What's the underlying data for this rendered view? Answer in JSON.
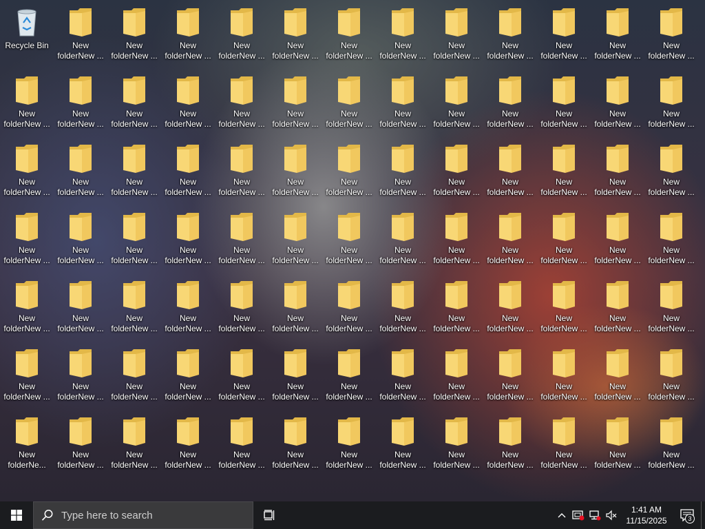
{
  "desktop": {
    "recycle_bin": {
      "label": "Recycle Bin",
      "icon": "recycle-bin-icon"
    },
    "folders": [
      "New folderNew ...",
      "New folderNew ...",
      "New folderNew ...",
      "New folderNew ...",
      "New folderNew ...",
      "New folderNew ...",
      "New folderNew ...",
      "New folderNew ...",
      "New folderNew ...",
      "New folderNew ...",
      "New folderNew ...",
      "New folderNew ...",
      "New folderNew ...",
      "New folderNew ...",
      "New folderNew ...",
      "New folderNew ...",
      "New folderNew ...",
      "New folderNew ...",
      "New folderNew ...",
      "New folderNew ...",
      "New folderNew ...",
      "New folderNew ...",
      "New folderNew ...",
      "New folderNew ...",
      "New folderNew ...",
      "New folderNew ...",
      "New folderNew ...",
      "New folderNew ...",
      "New folderNew ...",
      "New folderNew ...",
      "New folderNew ...",
      "New folderNew ...",
      "New folderNew ...",
      "New folderNew ...",
      "New folderNew ...",
      "New folderNew ...",
      "New folderNew ...",
      "New folderNew ...",
      "New folderNew ...",
      "New folderNew ...",
      "New folderNew ...",
      "New folderNew ...",
      "New folderNew ...",
      "New folderNew ...",
      "New folderNew ...",
      "New folderNew ...",
      "New folderNew ...",
      "New folderNew ...",
      "New folderNew ...",
      "New folderNew ...",
      "New folderNew ...",
      "New folderNew ...",
      "New folderNew ...",
      "New folderNew ...",
      "New folderNew ...",
      "New folderNew ...",
      "New folderNew ...",
      "New folderNew ...",
      "New folderNew ...",
      "New folderNew ...",
      "New folderNew ...",
      "New folderNew ...",
      "New folderNew ...",
      "New folderNew ...",
      "New folderNew ...",
      "New folderNew ...",
      "New folderNew ...",
      "New folderNew ...",
      "New folderNew ...",
      "New folderNew ...",
      "New folderNew ...",
      "New folderNew ...",
      "New folderNew ...",
      "New folderNew ...",
      "New folderNew ...",
      "New folderNew ...",
      "New folderNew ...",
      "New folderNe...",
      "New folderNew ...",
      "New folderNew ...",
      "New folderNew ...",
      "New folderNew ...",
      "New folderNew ...",
      "New folderNew ...",
      "New folderNew ...",
      "New folderNew ...",
      "New folderNew ...",
      "New folderNew ...",
      "New folderNew ...",
      "New folderNew ..."
    ],
    "folder_icon": "folder-icon"
  },
  "taskbar": {
    "start_icon": "windows-logo-icon",
    "search_placeholder": "Type here to search",
    "search_icon": "search-icon",
    "task_view_icon": "task-view-icon",
    "tray": {
      "chevron_icon": "chevron-up-icon",
      "icons": [
        "security-alert-icon",
        "network-disconnected-icon",
        "volume-muted-icon"
      ]
    },
    "clock": {
      "time": "1:41 AM",
      "date": "11/15/2025"
    },
    "notification_count": "3",
    "notification_icon": "action-center-icon"
  },
  "colors": {
    "taskbar_bg": "#1b1c1f",
    "search_bg": "#3a3a3c",
    "folder_front": "#f8d775",
    "folder_back": "#e3b848"
  }
}
